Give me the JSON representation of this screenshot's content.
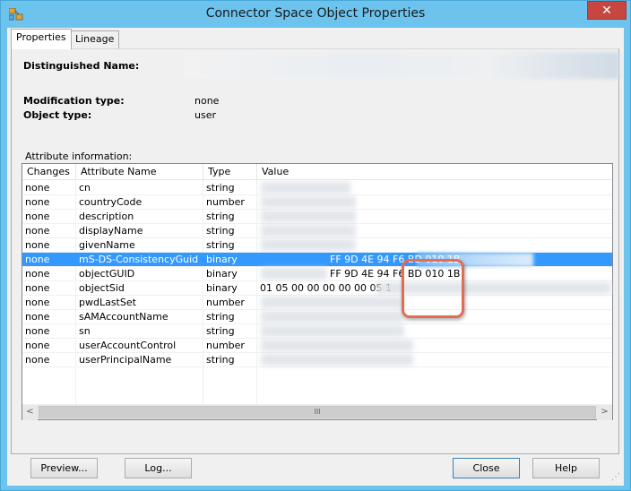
{
  "window": {
    "title": "Connector Space Object Properties",
    "close_glyph": "✕",
    "app_icon": "network-objects-icon",
    "accent_color": "#6cc4ee"
  },
  "tabs": [
    {
      "label": "Properties",
      "active": true
    },
    {
      "label": "Lineage",
      "active": false
    }
  ],
  "properties": {
    "dn_label": "Distinguished Name:",
    "modification_type_label": "Modification type:",
    "modification_type_value": "none",
    "object_type_label": "Object type:",
    "object_type_value": "user",
    "attr_info_label": "Attribute information:"
  },
  "grid": {
    "columns": [
      "Changes",
      "Attribute Name",
      "Type",
      "Value"
    ],
    "rows": [
      {
        "changes": "none",
        "name": "cn",
        "type": "string",
        "value": ""
      },
      {
        "changes": "none",
        "name": "countryCode",
        "type": "number",
        "value": ""
      },
      {
        "changes": "none",
        "name": "description",
        "type": "string",
        "value": ""
      },
      {
        "changes": "none",
        "name": "displayName",
        "type": "string",
        "value": ""
      },
      {
        "changes": "none",
        "name": "givenName",
        "type": "string",
        "value": ""
      },
      {
        "changes": "none",
        "name": "mS-DS-ConsistencyGuid",
        "type": "binary",
        "value": "FF 9D 4E 94 F6 BD 010 1B",
        "selected": true
      },
      {
        "changes": "none",
        "name": "objectGUID",
        "type": "binary",
        "value": "FF 9D 4E 94 F6 BD 010 1B"
      },
      {
        "changes": "none",
        "name": "objectSid",
        "type": "binary",
        "value": "01 05 00 00 00 00 00 05 1"
      },
      {
        "changes": "none",
        "name": "pwdLastSet",
        "type": "number",
        "value": ""
      },
      {
        "changes": "none",
        "name": "sAMAccountName",
        "type": "string",
        "value": ""
      },
      {
        "changes": "none",
        "name": "sn",
        "type": "string",
        "value": ""
      },
      {
        "changes": "none",
        "name": "userAccountControl",
        "type": "number",
        "value": ""
      },
      {
        "changes": "none",
        "name": "userPrincipalName",
        "type": "string",
        "value": ""
      }
    ],
    "scroll_left_glyph": "<",
    "scroll_right_glyph": ">",
    "scroll_thumb_grip": "III"
  },
  "buttons": {
    "preview": "Preview...",
    "log": "Log...",
    "close": "Close",
    "help": "Help"
  },
  "colors": {
    "selection": "#3399ff",
    "callout": "#e36c55"
  }
}
